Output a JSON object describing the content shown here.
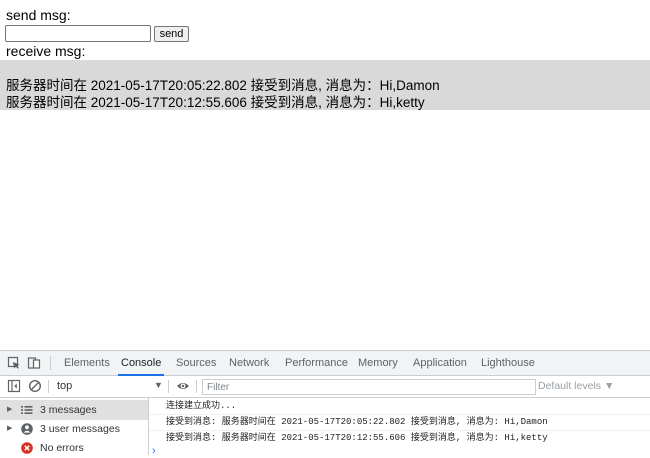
{
  "page": {
    "send_label": "send msg:",
    "input_value": "",
    "send_button": "send",
    "receive_label": "receive msg:",
    "messages": [
      "服务器时间在 2021-05-17T20:05:22.802 接受到消息, 消息为：Hi,Damon",
      "服务器时间在 2021-05-17T20:12:55.606 接受到消息, 消息为：Hi,ketty"
    ]
  },
  "devtools": {
    "tabs": [
      "Elements",
      "Console",
      "Sources",
      "Network",
      "Performance",
      "Memory",
      "Application",
      "Lighthouse"
    ],
    "active_tab": "Console",
    "context": "top",
    "filter_placeholder": "Filter",
    "levels_label": "Default levels ▼",
    "sidebar": [
      {
        "label": "3 messages",
        "icon": "list-icon"
      },
      {
        "label": "3 user messages",
        "icon": "user-icon"
      },
      {
        "label": "No errors",
        "icon": "error-icon"
      }
    ],
    "console_lines": [
      "连接建立成功...",
      "接受到消息: 服务器时间在 2021-05-17T20:05:22.802 接受到消息, 消息为: Hi,Damon",
      "接受到消息: 服务器时间在 2021-05-17T20:12:55.606 接受到消息, 消息为: Hi,ketty"
    ],
    "accent_color": "#1a73e8",
    "error_color": "#d93025"
  }
}
